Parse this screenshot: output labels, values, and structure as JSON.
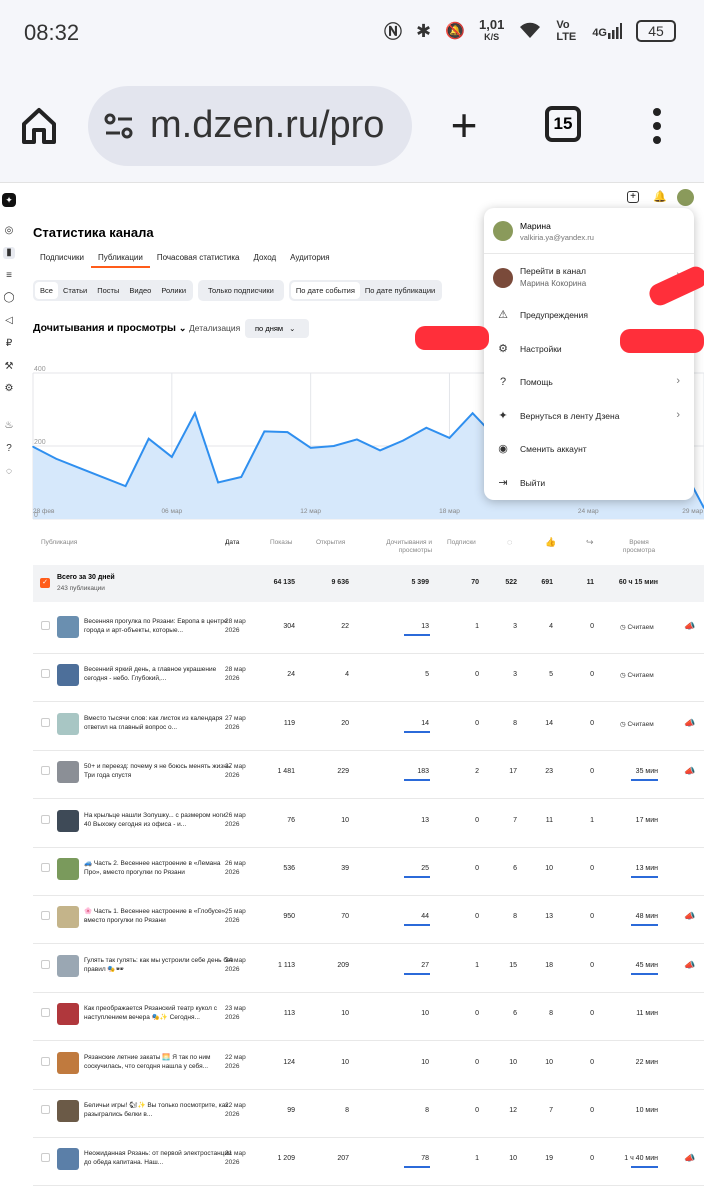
{
  "status_bar": {
    "time": "08:32",
    "speed_value": "1,01",
    "speed_unit": "K/S",
    "net_label": "Vo LTE",
    "net_type": "4G",
    "battery": "45"
  },
  "browser": {
    "url": "m.dzen.ru/pro",
    "tab_count": "15"
  },
  "page": {
    "title": "Статистика канала",
    "tabs": [
      "Подписчики",
      "Публикации",
      "Почасовая статистика",
      "Доход",
      "Аудитория"
    ],
    "active_tab": "Публикации",
    "filters_type": [
      "Все",
      "Статьи",
      "Посты",
      "Видео",
      "Ролики"
    ],
    "filter_subs": "Только подписчики",
    "filters_date": [
      "По дате события",
      "По дате публикации"
    ],
    "chart_section_title": "Дочитывания и просмотры",
    "detail_label": "Детализация",
    "detail_value": "по дням"
  },
  "chart_data": {
    "type": "area",
    "x": [
      "28 фев",
      "1 мар",
      "2 мар",
      "3 мар",
      "4 мар",
      "5 мар",
      "6 мар",
      "7 мар",
      "8 мар",
      "9 мар",
      "10 мар",
      "11 мар",
      "12 мар",
      "13 мар",
      "14 мар",
      "15 мар",
      "16 мар",
      "17 мар",
      "18 мар",
      "19 мар",
      "20 мар",
      "21 мар",
      "22 мар",
      "23 мар",
      "24 мар",
      "25 мар",
      "26 мар",
      "27 мар",
      "28 мар",
      "29 мар"
    ],
    "values": [
      198,
      165,
      140,
      115,
      90,
      220,
      170,
      290,
      100,
      115,
      240,
      238,
      195,
      200,
      218,
      188,
      215,
      250,
      222,
      290,
      223,
      100,
      160,
      170,
      165,
      180,
      190,
      170,
      150,
      30
    ],
    "x_tick_labels": [
      "28 фев",
      "06 мар",
      "12 мар",
      "18 мар",
      "24 мар",
      "29 мар"
    ],
    "y_tick_labels": [
      "400",
      "200",
      "0"
    ],
    "ylim": [
      0,
      400
    ],
    "grid": true
  },
  "table": {
    "headers": {
      "pub": "Публикация",
      "date": "Дата",
      "shows": "Показы",
      "opens": "Открытия",
      "reads": "Дочитывания и просмотры",
      "subs": "Подписки",
      "comments_icon": "comment-icon",
      "likes_icon": "like-icon",
      "reposts_icon": "repost-icon",
      "time": "Время просмотра"
    },
    "total": {
      "label": "Всего за 30 дней",
      "sub": "243 публикации",
      "shows": "64 135",
      "opens": "9 636",
      "reads": "5 399",
      "subs": "70",
      "comments": "522",
      "likes": "691",
      "reposts": "11",
      "time": "60 ч 15 мин"
    },
    "rows": [
      {
        "title": "Весенняя прогулка по Рязани: Европа в центре города и арт-объекты, которые...",
        "date": "28 мар 2026",
        "shows": "304",
        "opens": "22",
        "reads": "13",
        "subs": "1",
        "comments": "3",
        "likes": "4",
        "reposts": "0",
        "time": "Считаем",
        "counting": true,
        "promo": true,
        "ul_reads": true,
        "ul_time": false,
        "thumb": "#6a8fb0"
      },
      {
        "title": "Весенний яркий день, а главное украшение сегодня - небо. Глубокий,...",
        "date": "28 мар 2026",
        "shows": "24",
        "opens": "4",
        "reads": "5",
        "subs": "0",
        "comments": "3",
        "likes": "5",
        "reposts": "0",
        "time": "Считаем",
        "counting": true,
        "promo": false,
        "ul_reads": false,
        "ul_time": false,
        "thumb": "#4d6f9a"
      },
      {
        "title": "Вместо тысячи слов: как листок из календаря ответил на главный вопрос о...",
        "date": "27 мар 2026",
        "shows": "119",
        "opens": "20",
        "reads": "14",
        "subs": "0",
        "comments": "8",
        "likes": "14",
        "reposts": "0",
        "time": "Считаем",
        "counting": true,
        "promo": true,
        "ul_reads": true,
        "ul_time": false,
        "thumb": "#a8c6c4"
      },
      {
        "title": "50+ и переезд: почему я не боюсь менять жизнь. Три года спустя",
        "date": "27 мар 2026",
        "shows": "1 481",
        "opens": "229",
        "reads": "183",
        "subs": "2",
        "comments": "17",
        "likes": "23",
        "reposts": "0",
        "time": "35 мин",
        "counting": false,
        "promo": true,
        "ul_reads": true,
        "ul_time": true,
        "thumb": "#8b8f96"
      },
      {
        "title": "На крыльце нашли Золушку... с размером ноги 40 Выхожу сегодня из офиса - и...",
        "date": "26 мар 2026",
        "shows": "76",
        "opens": "10",
        "reads": "13",
        "subs": "0",
        "comments": "7",
        "likes": "11",
        "reposts": "1",
        "time": "17 мин",
        "counting": false,
        "promo": false,
        "ul_reads": false,
        "ul_time": false,
        "thumb": "#3e4a57"
      },
      {
        "title": "🚙 Часть 2. Весеннее настроение в «Лемана Про», вместо прогулки по Рязани",
        "date": "26 мар 2026",
        "shows": "536",
        "opens": "39",
        "reads": "25",
        "subs": "0",
        "comments": "6",
        "likes": "10",
        "reposts": "0",
        "time": "13 мин",
        "counting": false,
        "promo": false,
        "ul_reads": true,
        "ul_time": true,
        "thumb": "#7a9a5c"
      },
      {
        "title": "🌸 Часть 1. Весеннее настроение в «Глобусе», вместо прогулки по Рязани",
        "date": "25 мар 2026",
        "shows": "950",
        "opens": "70",
        "reads": "44",
        "subs": "0",
        "comments": "8",
        "likes": "13",
        "reposts": "0",
        "time": "48 мин",
        "counting": false,
        "promo": true,
        "ul_reads": true,
        "ul_time": true,
        "thumb": "#c4b48a"
      },
      {
        "title": "Гулять так гулять: как мы устроили себе день без правил 🎭🕶",
        "date": "24 мар 2026",
        "shows": "1 113",
        "opens": "209",
        "reads": "27",
        "subs": "1",
        "comments": "15",
        "likes": "18",
        "reposts": "0",
        "time": "45 мин",
        "counting": false,
        "promo": true,
        "ul_reads": true,
        "ul_time": true,
        "thumb": "#9aa7b3"
      },
      {
        "title": "Как преображается Рязанский театр кукол с наступлением вечера 🎭✨ Сегодня...",
        "date": "23 мар 2026",
        "shows": "113",
        "opens": "10",
        "reads": "10",
        "subs": "0",
        "comments": "6",
        "likes": "8",
        "reposts": "0",
        "time": "11 мин",
        "counting": false,
        "promo": false,
        "ul_reads": false,
        "ul_time": false,
        "thumb": "#b0373c"
      },
      {
        "title": "Рязанские летние закаты 🌅 Я так по ним соскучилась, что сегодня нашла у себя...",
        "date": "22 мар 2026",
        "shows": "124",
        "opens": "10",
        "reads": "10",
        "subs": "0",
        "comments": "10",
        "likes": "10",
        "reposts": "0",
        "time": "22 мин",
        "counting": false,
        "promo": false,
        "ul_reads": false,
        "ul_time": false,
        "thumb": "#c07a3e"
      },
      {
        "title": "Беличьи игры! 🐿✨ Вы только посмотрите, как разыгрались белки в...",
        "date": "22 мар 2026",
        "shows": "99",
        "opens": "8",
        "reads": "8",
        "subs": "0",
        "comments": "12",
        "likes": "7",
        "reposts": "0",
        "time": "10 мин",
        "counting": false,
        "promo": false,
        "ul_reads": false,
        "ul_time": false,
        "thumb": "#6b5a47"
      },
      {
        "title": "Неожиданная Рязань: от первой электростанции до обеда капитана. Наш...",
        "date": "21 мар 2026",
        "shows": "1 209",
        "opens": "207",
        "reads": "78",
        "subs": "1",
        "comments": "10",
        "likes": "19",
        "reposts": "0",
        "time": "1 ч 40 мин",
        "counting": false,
        "promo": true,
        "ul_reads": true,
        "ul_time": true,
        "thumb": "#5b7fa8"
      }
    ]
  },
  "menu": {
    "user_name": "Марина",
    "user_email": "valkiria.ya@yandex.ru",
    "go_channel": "Перейти в канал",
    "channel_name": "Марина Кокорина",
    "warnings": "Предупреждения",
    "settings": "Настройки",
    "help": "Помощь",
    "back_feed": "Вернуться в ленту Дзена",
    "switch": "Сменить аккаунт",
    "logout": "Выйти"
  },
  "colors": {
    "accent": "#ff5c1a",
    "chart_fill": "#d6e8fb",
    "chart_line": "#2f8fef",
    "underline": "#2b6ad9",
    "redaction": "#ff2f3a"
  }
}
